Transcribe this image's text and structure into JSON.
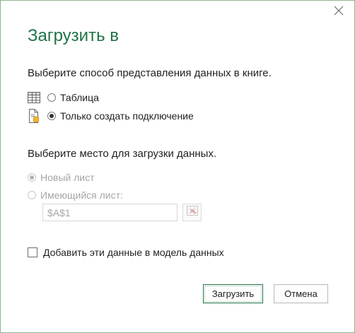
{
  "dialog": {
    "title": "Загрузить в",
    "close_icon": "close-icon"
  },
  "view_section": {
    "prompt": "Выберите способ представления данных в книге.",
    "options": [
      {
        "label": "Таблица",
        "icon": "table-icon",
        "selected": false
      },
      {
        "label": "Только создать подключение",
        "icon": "connection-only-icon",
        "selected": true
      }
    ]
  },
  "location_section": {
    "prompt": "Выберите место для загрузки данных.",
    "options": [
      {
        "label": "Новый лист",
        "selected": true,
        "enabled": false
      },
      {
        "label": "Имеющийся лист:",
        "selected": false,
        "enabled": false
      }
    ],
    "cell_reference": "$A$1",
    "range_picker_icon": "range-select-icon"
  },
  "data_model": {
    "label": "Добавить эти данные в модель данных",
    "checked": false
  },
  "buttons": {
    "load": "Загрузить",
    "cancel": "Отмена"
  },
  "colors": {
    "accent": "#217346",
    "disabled_text": "#a6a6a6",
    "border": "#8db48e"
  }
}
